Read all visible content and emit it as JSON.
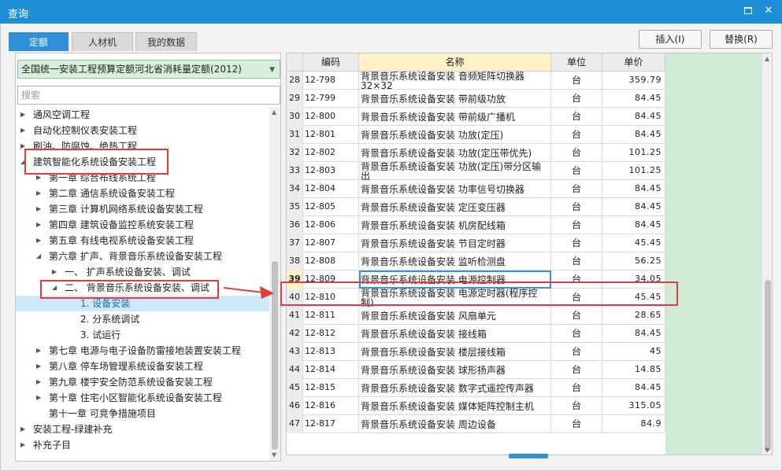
{
  "window": {
    "title": "查询"
  },
  "tabs": [
    {
      "label": "定额",
      "active": true
    },
    {
      "label": "人材机",
      "active": false
    },
    {
      "label": "我的数据",
      "active": false
    }
  ],
  "buttons": {
    "insert": "插入(I)",
    "replace": "替换(R)"
  },
  "library": {
    "selected": "全国统一安装工程预算定额河北省消耗量定额(2012)"
  },
  "search": {
    "placeholder": "搜索"
  },
  "tree": [
    {
      "label": "通风空调工程",
      "level": 0,
      "caret": "right"
    },
    {
      "label": "自动化控制仪表安装工程",
      "level": 0,
      "caret": "right"
    },
    {
      "label": "刷油、防腐蚀、绝热工程",
      "level": 0,
      "caret": "right"
    },
    {
      "label": "建筑智能化系统设备安装工程",
      "level": 0,
      "caret": "down"
    },
    {
      "label": "第一章 综合布线系统工程",
      "level": 1,
      "caret": "right"
    },
    {
      "label": "第二章 通信系统设备安装工程",
      "level": 1,
      "caret": "right"
    },
    {
      "label": "第三章 计算机网络系统设备安装工程",
      "level": 1,
      "caret": "right"
    },
    {
      "label": "第四章 建筑设备监控系统安装工程",
      "level": 1,
      "caret": "right"
    },
    {
      "label": "第五章 有线电视系统设备安装工程",
      "level": 1,
      "caret": "right"
    },
    {
      "label": "第六章 扩声、背景音乐系统设备安装工程",
      "level": 1,
      "caret": "down"
    },
    {
      "label": "一、 扩声系统设备安装、调试",
      "level": 2,
      "caret": "right"
    },
    {
      "label": "二、 背景音乐系统设备安装、调试",
      "level": 2,
      "caret": "down"
    },
    {
      "label": "1. 设备安装",
      "level": 3,
      "caret": "",
      "selected": true
    },
    {
      "label": "2. 分系统调试",
      "level": 3,
      "caret": ""
    },
    {
      "label": "3. 试运行",
      "level": 3,
      "caret": ""
    },
    {
      "label": "第七章 电源与电子设备防雷接地装置安装工程",
      "level": 1,
      "caret": "right"
    },
    {
      "label": "第八章 停车场管理系统设备安装工程",
      "level": 1,
      "caret": "right"
    },
    {
      "label": "第九章 楼宇安全防范系统设备安装工程",
      "level": 1,
      "caret": "right"
    },
    {
      "label": "第十章 住宅小区智能化系统设备安装工程",
      "level": 1,
      "caret": "right"
    },
    {
      "label": "第十一章 可竞争措施项目",
      "level": 1,
      "caret": ""
    },
    {
      "label": "安装工程-绿建补充",
      "level": 0,
      "caret": "right"
    },
    {
      "label": "补充子目",
      "level": 0,
      "caret": "right"
    }
  ],
  "table": {
    "headers": {
      "code": "编码",
      "name": "名称",
      "unit": "单位",
      "price": "单价"
    },
    "rows": [
      {
        "no": "28",
        "code": "12-798",
        "name": [
          "背景音乐系统设备安装 音频矩阵切换器",
          "32×32"
        ],
        "unit": "台",
        "price": "359.79"
      },
      {
        "no": "29",
        "code": "12-799",
        "name": [
          "背景音乐系统设备安装 带前级功放"
        ],
        "unit": "台",
        "price": "84.45"
      },
      {
        "no": "30",
        "code": "12-800",
        "name": [
          "背景音乐系统设备安装 带前级广播机"
        ],
        "unit": "台",
        "price": "84.45"
      },
      {
        "no": "31",
        "code": "12-801",
        "name": [
          "背景音乐系统设备安装 功放(定压)"
        ],
        "unit": "台",
        "price": "84.45"
      },
      {
        "no": "32",
        "code": "12-802",
        "name": [
          "背景音乐系统设备安装 功放(定压带优先)"
        ],
        "unit": "台",
        "price": "101.25"
      },
      {
        "no": "33",
        "code": "12-803",
        "name": [
          "背景音乐系统设备安装 功放(定压)带分区输",
          "出"
        ],
        "unit": "台",
        "price": "101.25"
      },
      {
        "no": "34",
        "code": "12-804",
        "name": [
          "背景音乐系统设备安装 功率信号切换器"
        ],
        "unit": "台",
        "price": "84.45"
      },
      {
        "no": "35",
        "code": "12-805",
        "name": [
          "背景音乐系统设备安装 定压变压器"
        ],
        "unit": "台",
        "price": "84.45"
      },
      {
        "no": "36",
        "code": "12-806",
        "name": [
          "背景音乐系统设备安装 机房配线箱"
        ],
        "unit": "台",
        "price": "84.45"
      },
      {
        "no": "37",
        "code": "12-807",
        "name": [
          "背景音乐系统设备安装 节目定时器"
        ],
        "unit": "台",
        "price": "45.45"
      },
      {
        "no": "38",
        "code": "12-808",
        "name": [
          "背景音乐系统设备安装 监听检测盘"
        ],
        "unit": "台",
        "price": "56.25"
      },
      {
        "no": "39",
        "code": "12-809",
        "name": [
          "背景音乐系统设备安装 电源控制器"
        ],
        "unit": "台",
        "price": "34.05",
        "selected": true
      },
      {
        "no": "40",
        "code": "12-810",
        "name": [
          "背景音乐系统设备安装 电源定时器(程序控",
          "制)"
        ],
        "unit": "台",
        "price": "45.45"
      },
      {
        "no": "41",
        "code": "12-811",
        "name": [
          "背景音乐系统设备安装 风扇单元"
        ],
        "unit": "台",
        "price": "28.65"
      },
      {
        "no": "42",
        "code": "12-812",
        "name": [
          "背景音乐系统设备安装 接线箱"
        ],
        "unit": "台",
        "price": "84.45"
      },
      {
        "no": "43",
        "code": "12-813",
        "name": [
          "背景音乐系统设备安装 楼层接线箱"
        ],
        "unit": "台",
        "price": "45"
      },
      {
        "no": "44",
        "code": "12-814",
        "name": [
          "背景音乐系统设备安装 球形扬声器"
        ],
        "unit": "台",
        "price": "14.85"
      },
      {
        "no": "45",
        "code": "12-815",
        "name": [
          "背景音乐系统设备安装 数字式遥控传声器"
        ],
        "unit": "台",
        "price": "84.45"
      },
      {
        "no": "46",
        "code": "12-816",
        "name": [
          "背景音乐系统设备安装 媒体矩阵控制主机"
        ],
        "unit": "台",
        "price": "315.05"
      },
      {
        "no": "47",
        "code": "12-817",
        "name": [
          "背景音乐系统设备安装 周边设备"
        ],
        "unit": "台",
        "price": "84.9"
      }
    ]
  },
  "colors": {
    "titlebar": "#1e8fd6",
    "accent": "#2f8fd8",
    "highlight": "#e43c3c",
    "price_column": "#d1ead5"
  },
  "icons": {
    "maximize": "maximize-icon",
    "close": "close-icon"
  }
}
